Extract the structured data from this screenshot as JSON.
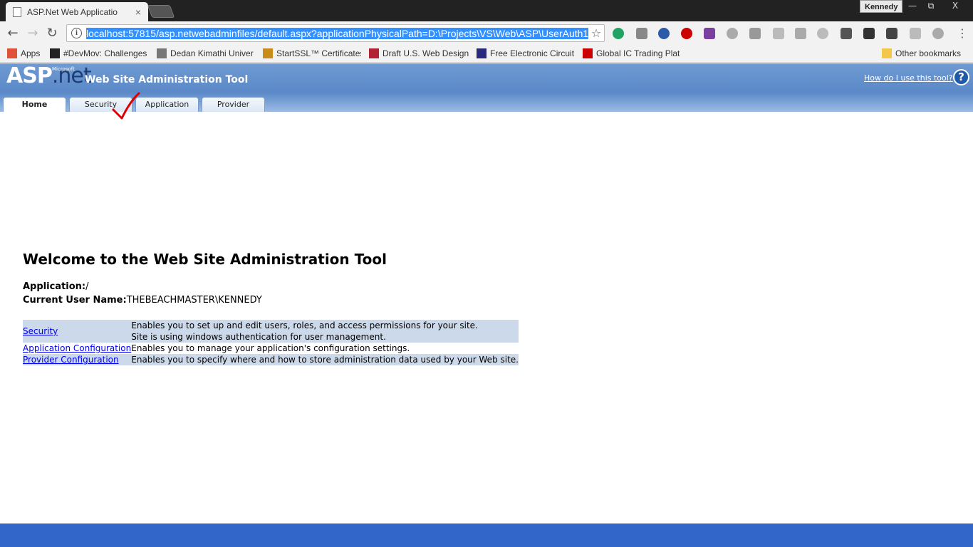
{
  "browser": {
    "tab_title": "ASP.Net Web Applicatio",
    "tab_close": "×",
    "profile": "Kennedy",
    "url": "localhost:57815/asp.netwebadminfiles/default.aspx?applicationPhysicalPath=D:\\Projects\\VS\\Web\\ASP\\UserAuth1\\",
    "window_controls": {
      "minimize": "—",
      "restore": "⧉",
      "close": "X"
    },
    "bookmarks": [
      {
        "label": "Apps",
        "icon": "apps-grid-icon",
        "color": "#e0513a"
      },
      {
        "label": "#DevMov: Challenges",
        "icon": "medium-m-icon",
        "color": "#222222"
      },
      {
        "label": "Dedan Kimathi Univer",
        "icon": "person-icon",
        "color": "#777777"
      },
      {
        "label": "StartSSL™ Certificates",
        "icon": "certificate-icon",
        "color": "#c98b1c"
      },
      {
        "label": "Draft U.S. Web Design",
        "icon": "us-flag-icon",
        "color": "#b22234"
      },
      {
        "label": "Free Electronic Circuit",
        "icon": "circuit-icon",
        "color": "#2a2a7a"
      },
      {
        "label": "Global IC Trading Plat",
        "icon": "ic-logo-icon",
        "color": "#cc0000"
      }
    ],
    "other_bookmarks": "Other bookmarks"
  },
  "wsat": {
    "logo_asp": "ASP",
    "logo_net": ".net",
    "logo_ms": "Microsoft",
    "title": "Web Site Administration Tool",
    "help_link": "How do I use this tool?",
    "help_icon": "?",
    "tabs": [
      {
        "label": "Home",
        "active": true
      },
      {
        "label": "Security",
        "active": false
      },
      {
        "label": "Application",
        "active": false
      },
      {
        "label": "Provider",
        "active": false
      }
    ]
  },
  "content": {
    "welcome": "Welcome to the Web Site Administration Tool",
    "application_label": "Application:",
    "application_value": "/",
    "user_label": "Current User Name:",
    "user_value": "THEBEACHMASTER\\KENNEDY",
    "rows": [
      {
        "link": "Security",
        "desc1": "Enables you to set up and edit users, roles, and access permissions for your site.",
        "desc2": "Site is using windows authentication for user management."
      },
      {
        "link": "Application Configuration",
        "desc1": "Enables you to manage your application's configuration settings."
      },
      {
        "link": "Provider Configuration",
        "desc1": "Enables you to specify where and how to store administration data used by your Web site."
      }
    ]
  },
  "colors": {
    "header_blue": "#5b89c8",
    "footer_blue": "#3267c9",
    "table_shade": "#ccd9ea",
    "annotation_red": "#e00000"
  }
}
